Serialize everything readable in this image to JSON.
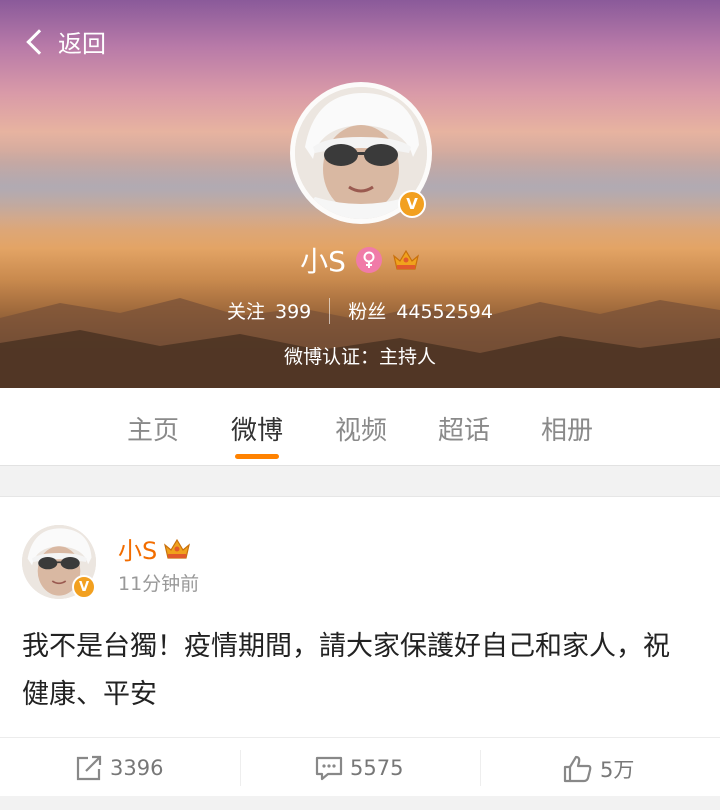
{
  "header": {
    "back_label": "返回",
    "user_name": "小S",
    "following_label": "关注",
    "following_count": "399",
    "followers_label": "粉丝",
    "followers_count": "44552594",
    "verification": "微博认证：主持人"
  },
  "tabs": [
    {
      "label": "主页",
      "active": false
    },
    {
      "label": "微博",
      "active": true
    },
    {
      "label": "视频",
      "active": false
    },
    {
      "label": "超话",
      "active": false
    },
    {
      "label": "相册",
      "active": false
    }
  ],
  "post": {
    "author": "小S",
    "time": "11分钟前",
    "text": "我不是台獨！疫情期間，請大家保護好自己和家人，祝 健康、平安",
    "reposts": "3396",
    "comments": "5575",
    "likes": "5万"
  },
  "icons": {
    "verified": "verified-v-icon",
    "gender": "female-icon",
    "vip": "crown-icon",
    "repost": "repost-icon",
    "comment": "comment-icon",
    "like": "thumbs-up-icon"
  },
  "colors": {
    "accent": "#ff8200",
    "name_orange": "#f26d00",
    "badge": "#f2a020"
  }
}
